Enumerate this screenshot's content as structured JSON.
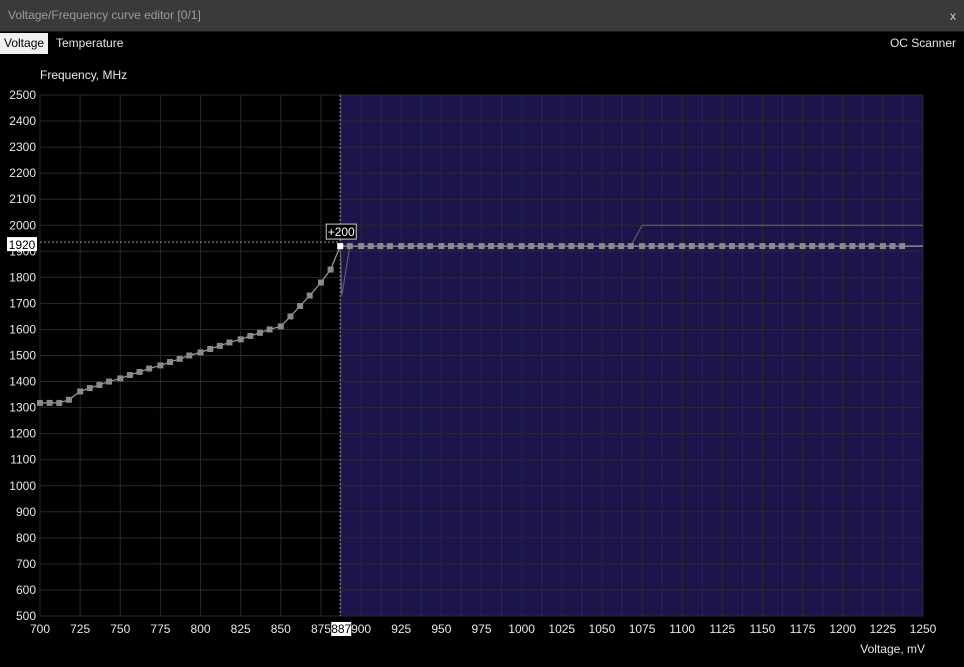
{
  "window": {
    "title": "Voltage/Frequency curve editor [0/1]",
    "close_label": "x"
  },
  "tabs": {
    "voltage": "Voltage",
    "temperature": "Temperature",
    "active": "Voltage",
    "oc_scanner": "OC Scanner"
  },
  "colors": {
    "background": "#000000",
    "grid": "#2a2a2a",
    "locked_region": "#1b154c",
    "curve": "#a0a0a0",
    "point": "#8a8a8a",
    "selected_point": "#ffffff"
  },
  "chart_data": {
    "type": "line",
    "xlabel": "Voltage, mV",
    "ylabel": "Frequency, MHz",
    "xlim": [
      700,
      1250
    ],
    "ylim": [
      500,
      2500
    ],
    "x_ticks": [
      700,
      725,
      750,
      775,
      800,
      825,
      850,
      875,
      900,
      925,
      950,
      975,
      1000,
      1025,
      1050,
      1075,
      1100,
      1125,
      1150,
      1175,
      1200,
      1225,
      1250
    ],
    "y_ticks": [
      500,
      600,
      700,
      800,
      900,
      1000,
      1100,
      1200,
      1300,
      1400,
      1500,
      1600,
      1700,
      1800,
      1900,
      2000,
      2100,
      2200,
      2300,
      2400,
      2500
    ],
    "selected": {
      "voltage": 887,
      "frequency": 1920,
      "offset_label": "+200",
      "voltage_label": "887",
      "frequency_label": "1920"
    },
    "locked_from_voltage": 887,
    "curve_points": [
      [
        700,
        1318
      ],
      [
        706,
        1318
      ],
      [
        712,
        1318
      ],
      [
        718,
        1330
      ],
      [
        725,
        1362
      ],
      [
        731,
        1375
      ],
      [
        737,
        1387
      ],
      [
        743,
        1400
      ],
      [
        750,
        1412
      ],
      [
        756,
        1425
      ],
      [
        762,
        1437
      ],
      [
        768,
        1450
      ],
      [
        775,
        1462
      ],
      [
        781,
        1475
      ],
      [
        787,
        1487
      ],
      [
        793,
        1500
      ],
      [
        800,
        1512
      ],
      [
        806,
        1525
      ],
      [
        812,
        1537
      ],
      [
        818,
        1550
      ],
      [
        825,
        1562
      ],
      [
        831,
        1575
      ],
      [
        837,
        1587
      ],
      [
        843,
        1600
      ],
      [
        850,
        1612
      ],
      [
        856,
        1650
      ],
      [
        862,
        1690
      ],
      [
        868,
        1730
      ],
      [
        875,
        1780
      ],
      [
        881,
        1830
      ],
      [
        887,
        1920
      ],
      [
        893,
        1920
      ],
      [
        900,
        1920
      ],
      [
        906,
        1920
      ],
      [
        912,
        1920
      ],
      [
        918,
        1920
      ],
      [
        925,
        1920
      ],
      [
        931,
        1920
      ],
      [
        937,
        1920
      ],
      [
        943,
        1920
      ],
      [
        950,
        1920
      ],
      [
        956,
        1920
      ],
      [
        962,
        1920
      ],
      [
        968,
        1920
      ],
      [
        975,
        1920
      ],
      [
        981,
        1920
      ],
      [
        987,
        1920
      ],
      [
        993,
        1920
      ],
      [
        1000,
        1920
      ],
      [
        1006,
        1920
      ],
      [
        1012,
        1920
      ],
      [
        1018,
        1920
      ],
      [
        1025,
        1920
      ],
      [
        1031,
        1920
      ],
      [
        1037,
        1920
      ],
      [
        1043,
        1920
      ],
      [
        1050,
        1920
      ],
      [
        1056,
        1920
      ],
      [
        1062,
        1920
      ],
      [
        1068,
        1920
      ],
      [
        1075,
        1920
      ],
      [
        1081,
        1920
      ],
      [
        1087,
        1920
      ],
      [
        1093,
        1920
      ],
      [
        1100,
        1920
      ],
      [
        1106,
        1920
      ],
      [
        1112,
        1920
      ],
      [
        1118,
        1920
      ],
      [
        1125,
        1920
      ],
      [
        1131,
        1920
      ],
      [
        1137,
        1920
      ],
      [
        1143,
        1920
      ],
      [
        1150,
        1920
      ],
      [
        1156,
        1920
      ],
      [
        1162,
        1920
      ],
      [
        1168,
        1920
      ],
      [
        1175,
        1920
      ],
      [
        1181,
        1920
      ],
      [
        1187,
        1920
      ],
      [
        1193,
        1920
      ],
      [
        1200,
        1920
      ],
      [
        1206,
        1920
      ],
      [
        1212,
        1920
      ],
      [
        1218,
        1920
      ],
      [
        1225,
        1920
      ],
      [
        1231,
        1920
      ],
      [
        1237,
        1920
      ]
    ],
    "reference_curve": [
      [
        887,
        1920
      ],
      [
        888,
        1730
      ],
      [
        893,
        1920
      ],
      [
        1068,
        1920
      ],
      [
        1075,
        2000
      ],
      [
        1250,
        2000
      ]
    ]
  }
}
